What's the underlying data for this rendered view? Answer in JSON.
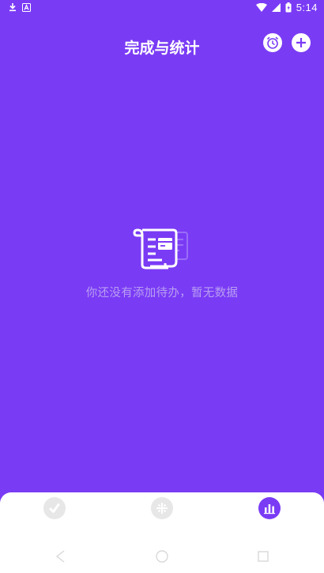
{
  "status_bar": {
    "time": "5:14",
    "icons": [
      "download-icon",
      "a-icon",
      "wifi-icon",
      "signal-icon",
      "battery-icon"
    ]
  },
  "header": {
    "title": "完成与统计",
    "actions": [
      "alarm-clock-icon",
      "add-icon"
    ]
  },
  "empty_state": {
    "message": "你还没有添加待办，暂无数据",
    "icon": "document-receipt-icon"
  },
  "tabs": [
    {
      "name": "done",
      "icon": "check-leaf-icon",
      "active": false
    },
    {
      "name": "todo",
      "icon": "grid-star-icon",
      "active": false
    },
    {
      "name": "stats",
      "icon": "bar-chart-icon",
      "active": true
    }
  ],
  "nav": [
    "back-icon",
    "home-icon",
    "recent-apps-icon"
  ],
  "colors": {
    "primary": "#7a3bf5",
    "white": "#ffffff",
    "empty_text": "#b89ff2",
    "tab_inactive": "#e7e7e7"
  }
}
